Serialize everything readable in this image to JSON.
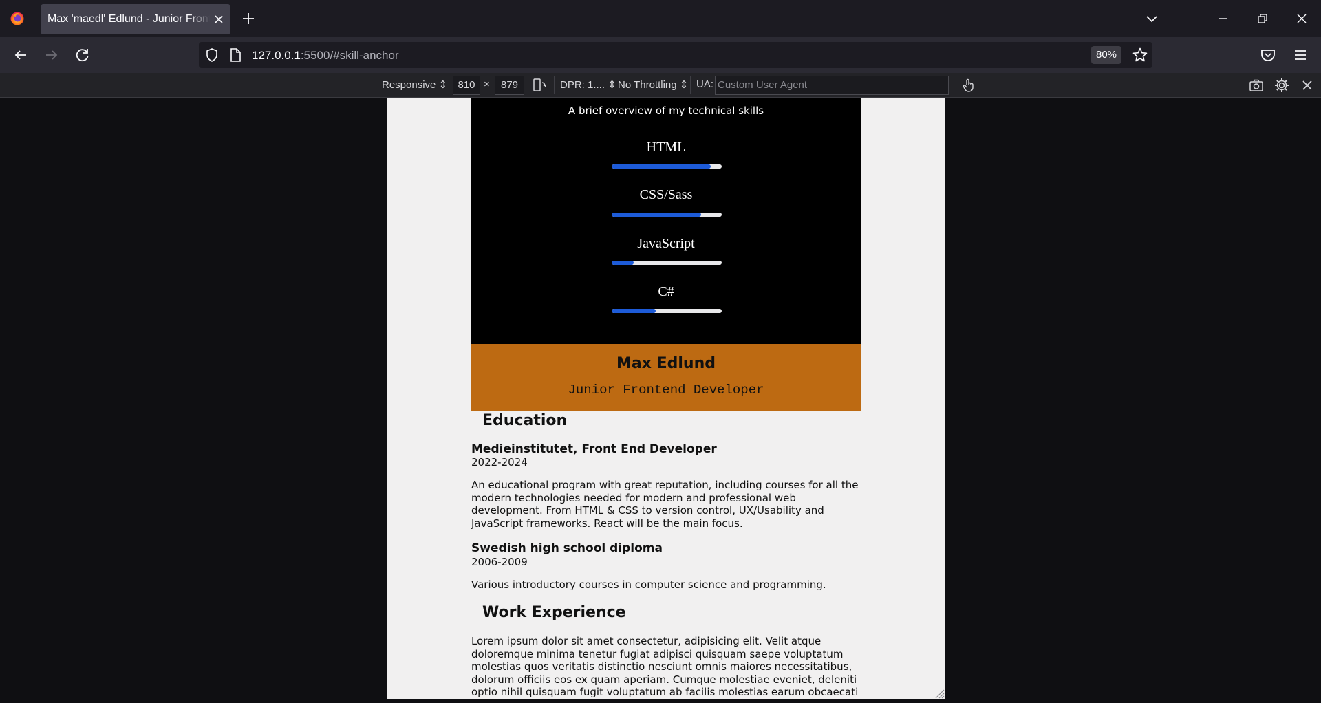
{
  "browser": {
    "tab_title": "Max 'maedl' Edlund - Junior Frontend Developer",
    "url_host": "127.0.0.1",
    "url_rest": ":5500/#skill-anchor",
    "zoom": "80%"
  },
  "rdm": {
    "device": "Responsive",
    "width": "810",
    "times": "×",
    "height": "879",
    "dpr": "DPR: 1....",
    "throttling": "No Throttling",
    "ua_label": "UA:",
    "ua_placeholder": "Custom User Agent"
  },
  "skills": {
    "intro": "A brief overview of my technical skills",
    "items": [
      {
        "name": "HTML",
        "level": 0.9
      },
      {
        "name": "CSS/Sass",
        "level": 0.81
      },
      {
        "name": "JavaScript",
        "level": 0.2
      },
      {
        "name": "C#",
        "level": 0.4
      }
    ]
  },
  "banner": {
    "name": "Max Edlund",
    "role": "Junior Frontend Developer"
  },
  "education": {
    "title": "Education",
    "entries": [
      {
        "title": "Medieinstitutet, Front End Developer",
        "years": "2022-2024",
        "desc": "An educational program with great reputation, including courses for all the modern technologies needed for modern and professional web development. From HTML & CSS to version control, UX/Usability and JavaScript frameworks. React will be the main focus."
      },
      {
        "title": "Swedish high school diploma",
        "years": "2006-2009",
        "desc": "Various introductory courses in computer science and programming."
      }
    ]
  },
  "work": {
    "title": "Work Experience",
    "desc": "Lorem ipsum dolor sit amet consectetur, adipisicing elit. Velit atque doloremque minima tenetur fugiat adipisci quisquam saepe voluptatum molestias quos veritatis distinctio nesciunt omnis maiores necessitatibus, dolorum officiis eos ex quam aperiam. Cumque molestiae eveniet, deleniti optio nihil quisquam fugit voluptatum ab facilis molestias earum obcaecati accusantium necessitatibus quasi placeat!"
  },
  "colors": {
    "accent_blue": "#1d5bd8",
    "banner_orange": "#bd6a12",
    "skills_bg": "#000000",
    "page_bg": "#f1f0f0"
  }
}
